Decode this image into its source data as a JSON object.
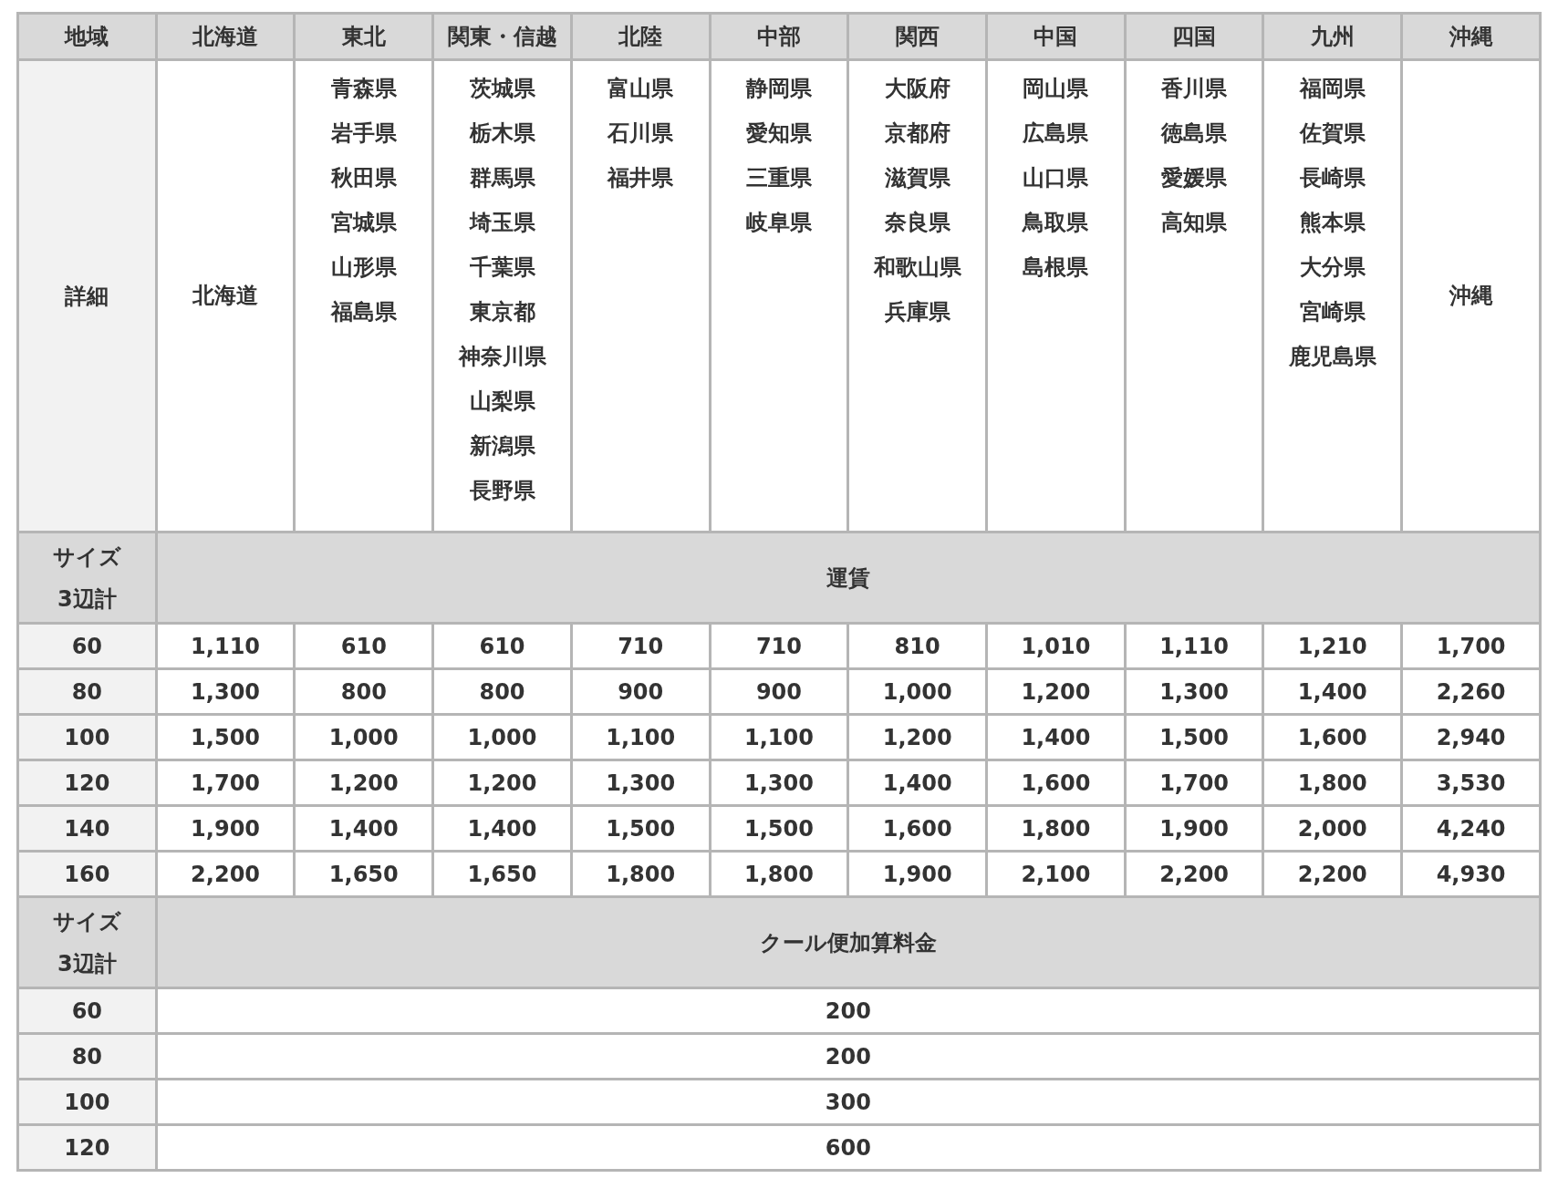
{
  "header": {
    "label": "地域",
    "regions": [
      "北海道",
      "東北",
      "関東・信越",
      "北陸",
      "中部",
      "関西",
      "中国",
      "四国",
      "九州",
      "沖縄"
    ]
  },
  "details": {
    "label": "詳細",
    "prefectures": [
      [
        "北海道"
      ],
      [
        "青森県",
        "岩手県",
        "秋田県",
        "宮城県",
        "山形県",
        "福島県"
      ],
      [
        "茨城県",
        "栃木県",
        "群馬県",
        "埼玉県",
        "千葉県",
        "東京都",
        "神奈川県",
        "山梨県",
        "新潟県",
        "長野県"
      ],
      [
        "富山県",
        "石川県",
        "福井県"
      ],
      [
        "静岡県",
        "愛知県",
        "三重県",
        "岐阜県"
      ],
      [
        "大阪府",
        "京都府",
        "滋賀県",
        "奈良県",
        "和歌山県",
        "兵庫県"
      ],
      [
        "岡山県",
        "広島県",
        "山口県",
        "鳥取県",
        "島根県"
      ],
      [
        "香川県",
        "徳島県",
        "愛媛県",
        "高知県"
      ],
      [
        "福岡県",
        "佐賀県",
        "長崎県",
        "熊本県",
        "大分県",
        "宮崎県",
        "鹿児島県"
      ],
      [
        "沖縄"
      ]
    ]
  },
  "fare_section": {
    "size_label": [
      "サイズ",
      "3辺計"
    ],
    "title": "運賃",
    "rows": [
      {
        "size": "60",
        "fares": [
          "1,110",
          "610",
          "610",
          "710",
          "710",
          "810",
          "1,010",
          "1,110",
          "1,210",
          "1,700"
        ]
      },
      {
        "size": "80",
        "fares": [
          "1,300",
          "800",
          "800",
          "900",
          "900",
          "1,000",
          "1,200",
          "1,300",
          "1,400",
          "2,260"
        ]
      },
      {
        "size": "100",
        "fares": [
          "1,500",
          "1,000",
          "1,000",
          "1,100",
          "1,100",
          "1,200",
          "1,400",
          "1,500",
          "1,600",
          "2,940"
        ]
      },
      {
        "size": "120",
        "fares": [
          "1,700",
          "1,200",
          "1,200",
          "1,300",
          "1,300",
          "1,400",
          "1,600",
          "1,700",
          "1,800",
          "3,530"
        ]
      },
      {
        "size": "140",
        "fares": [
          "1,900",
          "1,400",
          "1,400",
          "1,500",
          "1,500",
          "1,600",
          "1,800",
          "1,900",
          "2,000",
          "4,240"
        ]
      },
      {
        "size": "160",
        "fares": [
          "2,200",
          "1,650",
          "1,650",
          "1,800",
          "1,800",
          "1,900",
          "2,100",
          "2,200",
          "2,200",
          "4,930"
        ]
      }
    ]
  },
  "cool_section": {
    "size_label": [
      "サイズ",
      "3辺計"
    ],
    "title": "クール便加算料金",
    "rows": [
      {
        "size": "60",
        "fee": "200"
      },
      {
        "size": "80",
        "fee": "200"
      },
      {
        "size": "100",
        "fee": "300"
      },
      {
        "size": "120",
        "fee": "600"
      }
    ]
  }
}
